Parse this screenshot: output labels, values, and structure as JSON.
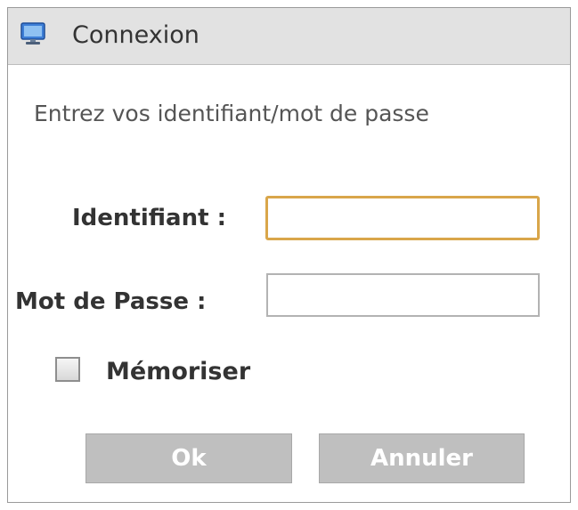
{
  "dialog": {
    "title": "Connexion",
    "title_icon": "computer-monitor-icon",
    "instruction": "Entrez vos identifiant/mot de passe"
  },
  "form": {
    "username_label": "Identifiant :",
    "username_value": "",
    "password_label": "Mot de Passe  :",
    "password_value": "",
    "remember_label": "Mémoriser",
    "remember_checked": false
  },
  "buttons": {
    "ok_label": "Ok",
    "cancel_label": "Annuler"
  },
  "colors": {
    "titlebar": "#e2e2e2",
    "focused_border": "#d9a64a",
    "button_bg": "#bfbfbf"
  }
}
